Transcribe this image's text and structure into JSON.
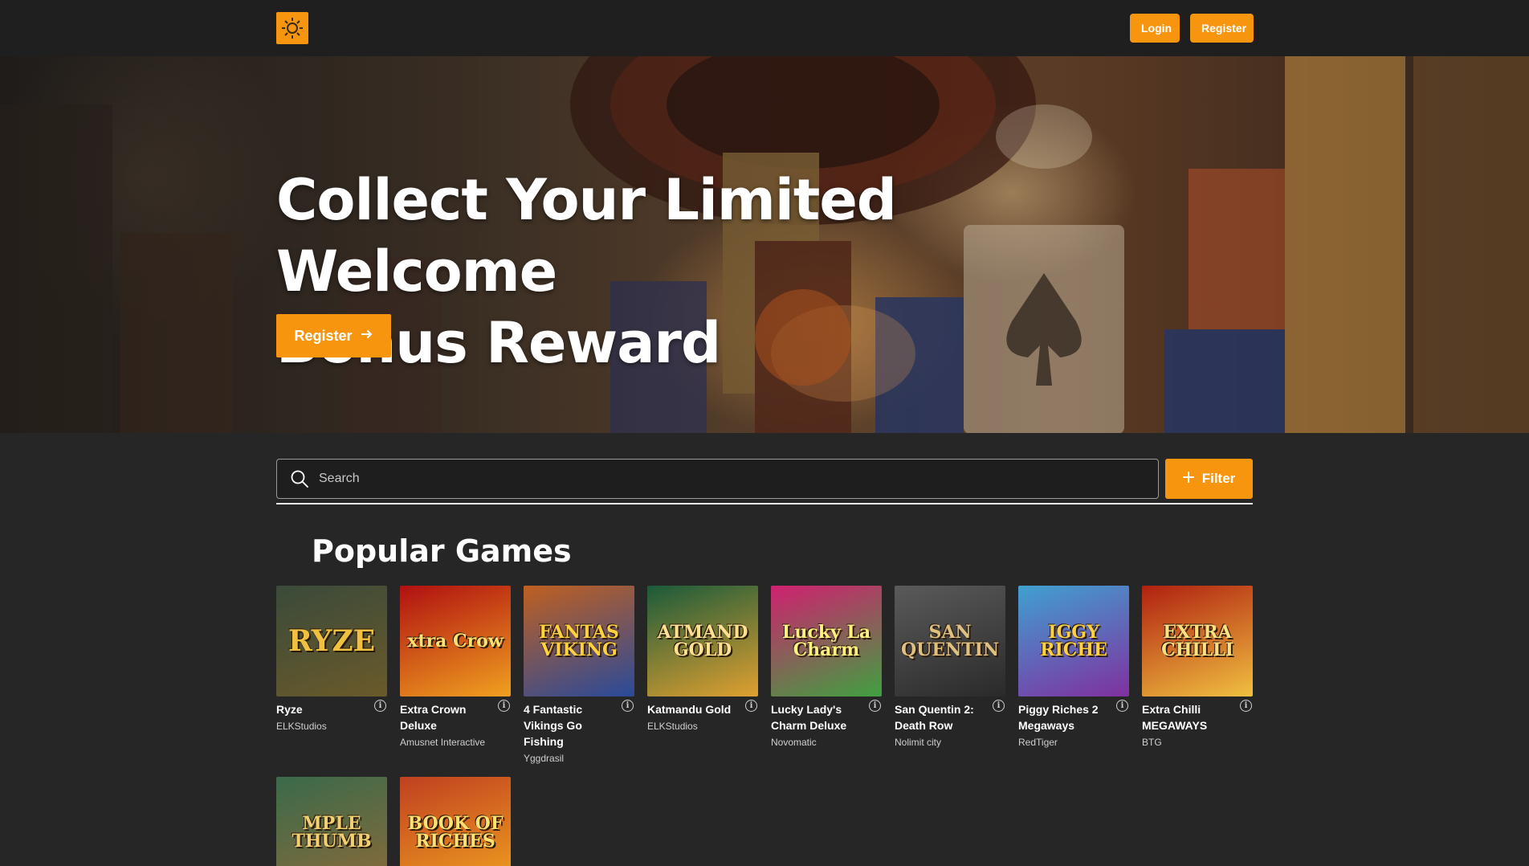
{
  "header": {
    "login_label": "Login",
    "register_label": "Register"
  },
  "hero": {
    "title_line1": "Collect Your Limited Welcome",
    "title_line2": "Bonus Reward",
    "cta_label": "Register"
  },
  "search": {
    "placeholder": "Search",
    "filter_label": "Filter"
  },
  "section": {
    "title": "Popular Games"
  },
  "games": [
    {
      "title": "Ryze",
      "provider": "ELKStudios",
      "thumb_text": "RYZE",
      "bg1": "#3a4a3a",
      "bg2": "#6a5a2a",
      "fg": "#f0c040"
    },
    {
      "title": "Extra Crown Deluxe",
      "provider": "Amusnet Interactive",
      "thumb_text": "xtra Crow",
      "bg1": "#b01010",
      "bg2": "#f0a020",
      "fg": "#ffe070"
    },
    {
      "title": "4 Fantastic Vikings Go Fishing",
      "provider": "Yggdrasil",
      "thumb_text": "FANTAS VIKING",
      "bg1": "#c06020",
      "bg2": "#2a4a9a",
      "fg": "#ffd040"
    },
    {
      "title": "Katmandu Gold",
      "provider": "ELKStudios",
      "thumb_text": "ATMAND GOLD",
      "bg1": "#1a5a3a",
      "bg2": "#e0a030",
      "fg": "#ffe090"
    },
    {
      "title": "Lucky Lady's Charm Deluxe",
      "provider": "Novomatic",
      "thumb_text": "Lucky La Charm",
      "bg1": "#d02070",
      "bg2": "#40a040",
      "fg": "#fff080"
    },
    {
      "title": "San Quentin 2: Death Row",
      "provider": "Nolimit city",
      "thumb_text": "SAN QUENTIN",
      "bg1": "#5a5a5a",
      "bg2": "#2a2a2a",
      "fg": "#e0c080"
    },
    {
      "title": "Piggy Riches 2 Megaways",
      "provider": "RedTiger",
      "thumb_text": "IGGY RICHE",
      "bg1": "#40a0d0",
      "bg2": "#8030a0",
      "fg": "#ffd040"
    },
    {
      "title": "Extra Chilli MEGAWAYS",
      "provider": "BTG",
      "thumb_text": "EXTRA CHILLI",
      "bg1": "#b02010",
      "bg2": "#f0c040",
      "fg": "#ffe080"
    },
    {
      "title": "",
      "provider": "",
      "thumb_text": "MPLE THUMB",
      "bg1": "#3a6a4a",
      "bg2": "#8a6a3a",
      "fg": "#f0d070"
    },
    {
      "title": "",
      "provider": "",
      "thumb_text": "BOOK OF RICHES",
      "bg1": "#c04020",
      "bg2": "#f0a020",
      "fg": "#ffe070"
    }
  ],
  "colors": {
    "accent": "#f7960e",
    "background": "#262626",
    "header": "#1f1f1f"
  }
}
